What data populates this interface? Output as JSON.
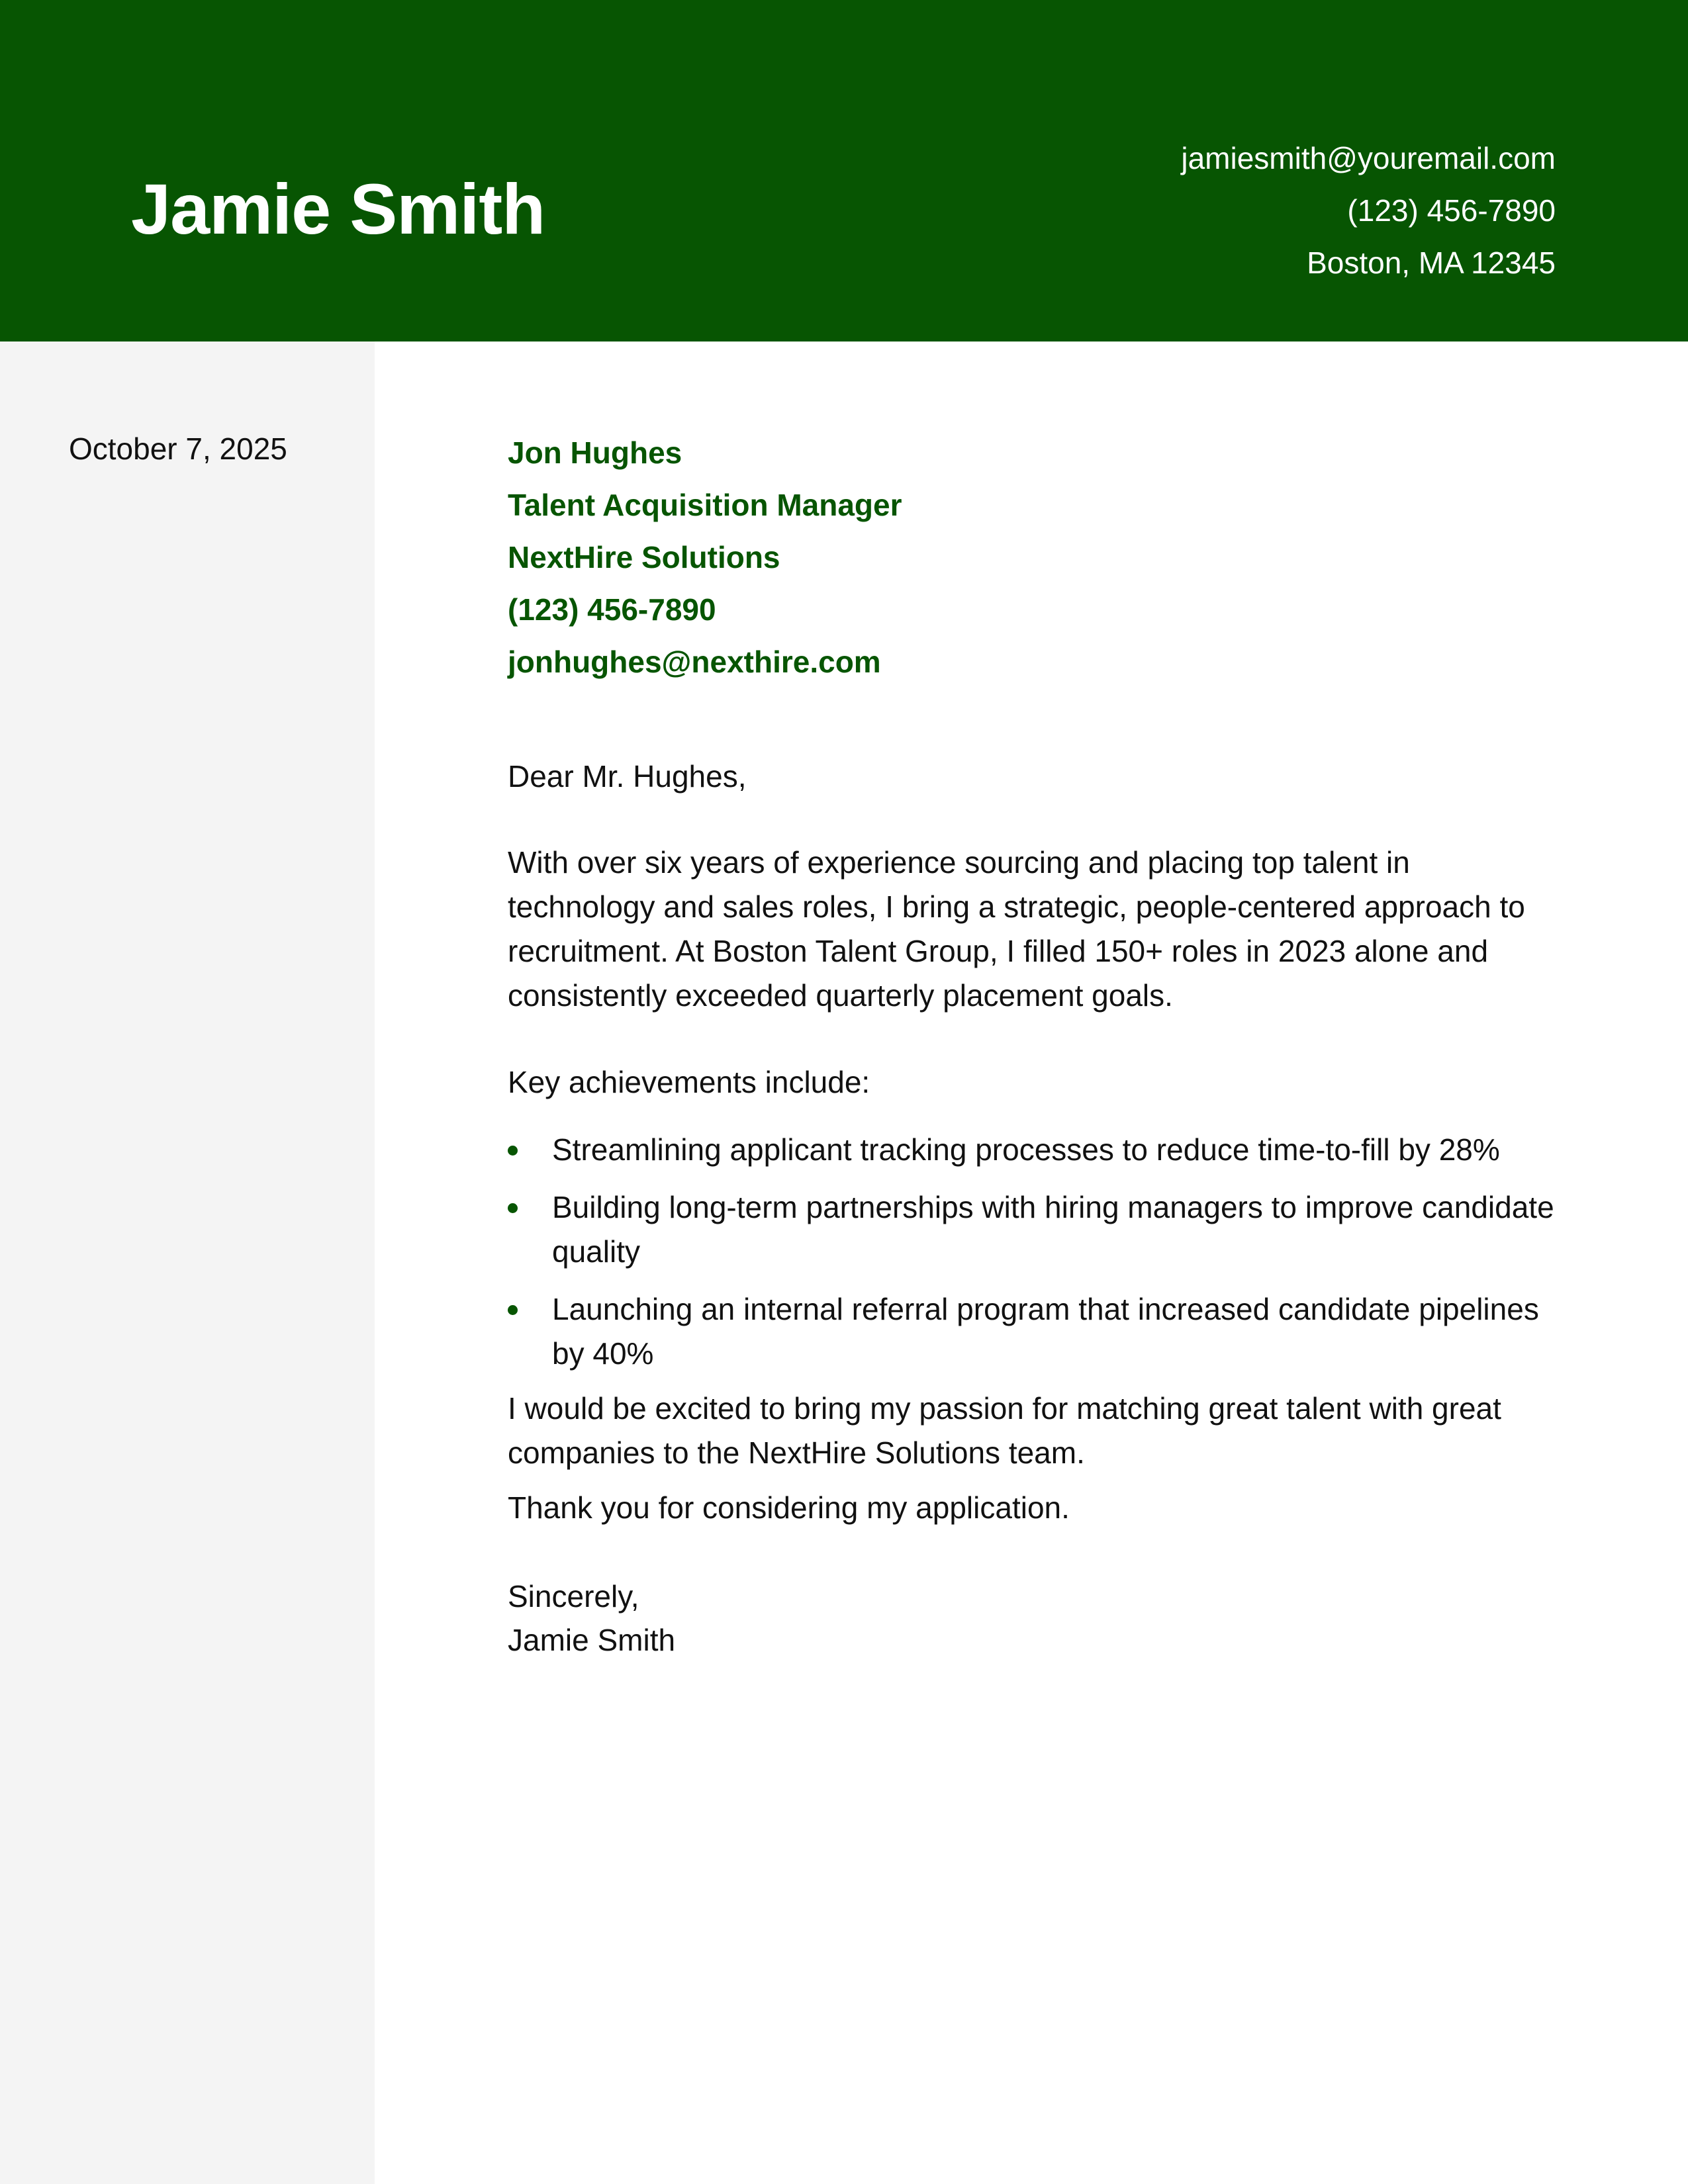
{
  "header": {
    "name": "Jamie Smith",
    "email": "jamiesmith@youremail.com",
    "phone": "(123) 456-7890",
    "location": "Boston, MA 12345",
    "color": "#075502"
  },
  "sidebar": {
    "date": "October 7, 2025",
    "background": "#f4f4f4"
  },
  "recipient": {
    "name": "Jon Hughes",
    "title": "Talent Acquisition Manager",
    "company": "NextHire Solutions",
    "phone": "(123) 456-7890",
    "email": "jonhughes@nexthire.com"
  },
  "letter": {
    "salutation": "Dear Mr. Hughes,",
    "paragraph1": "With over six years of experience sourcing and placing top talent in technology and sales roles, I bring a strategic, people-centered approach to recruitment. At Boston Talent Group, I filled 150+ roles in 2023 alone and consistently exceeded quarterly placement goals.",
    "achievements_intro": "Key achievements include:",
    "achievements": [
      "Streamlining applicant tracking processes to reduce time-to-fill by 28%",
      "Building long-term partnerships with hiring managers to improve candidate quality",
      "Launching an internal referral program that increased candidate pipelines by 40%"
    ],
    "paragraph2": "I would be excited to bring my passion for matching great talent with great companies to the NextHire Solutions team.",
    "thanks": "Thank you for considering my application.",
    "closing": "Sincerely,",
    "signature": "Jamie Smith"
  }
}
